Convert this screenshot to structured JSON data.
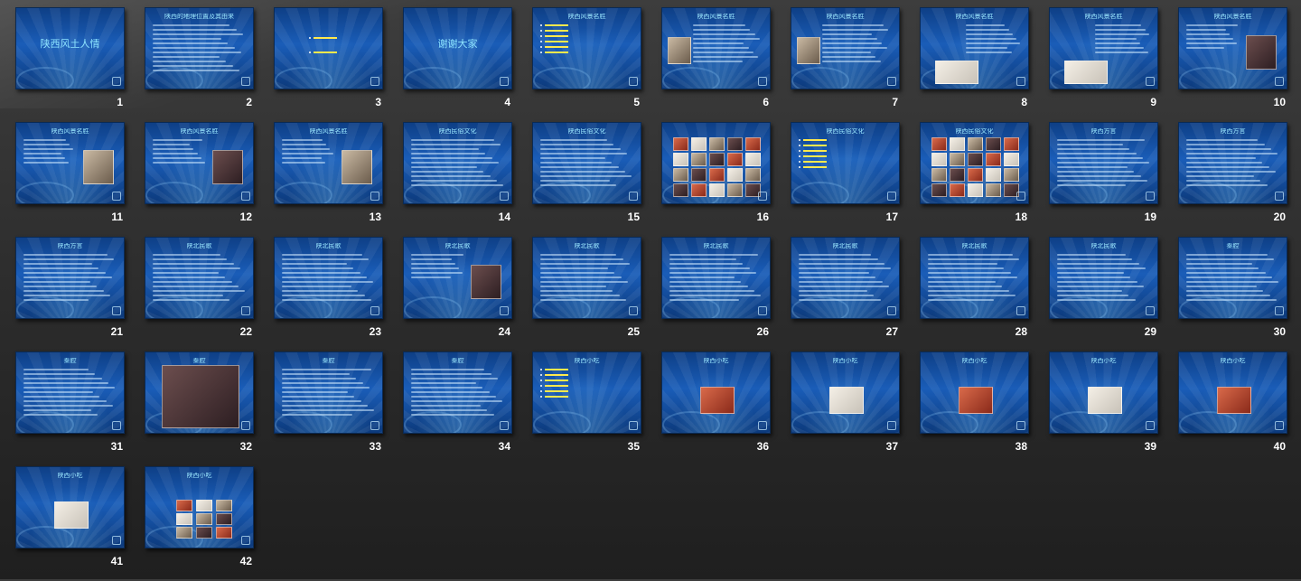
{
  "slides": [
    {
      "n": "1",
      "title": "陕西风土人情",
      "layout": "cover"
    },
    {
      "n": "2",
      "title": "陕西的地理位置及其由来",
      "layout": "text"
    },
    {
      "n": "3",
      "title": "",
      "layout": "menu2"
    },
    {
      "n": "4",
      "title": "谢谢大家",
      "layout": "cover"
    },
    {
      "n": "5",
      "title": "陕西风景名胜",
      "layout": "menu"
    },
    {
      "n": "6",
      "title": "陕西风景名胜",
      "layout": "pic-left"
    },
    {
      "n": "7",
      "title": "陕西风景名胜",
      "layout": "pic-left"
    },
    {
      "n": "8",
      "title": "陕西风景名胜",
      "layout": "pic-bottom"
    },
    {
      "n": "9",
      "title": "陕西风景名胜",
      "layout": "pic-bottom"
    },
    {
      "n": "10",
      "title": "陕西风景名胜",
      "layout": "pic-right"
    },
    {
      "n": "11",
      "title": "陕西风景名胜",
      "layout": "pic-right"
    },
    {
      "n": "12",
      "title": "陕西风景名胜",
      "layout": "pic-right"
    },
    {
      "n": "13",
      "title": "陕西风景名胜",
      "layout": "pic-right"
    },
    {
      "n": "14",
      "title": "陕西民俗文化",
      "layout": "text"
    },
    {
      "n": "15",
      "title": "陕西民俗文化",
      "layout": "text"
    },
    {
      "n": "16",
      "title": "",
      "layout": "grid"
    },
    {
      "n": "17",
      "title": "陕西民俗文化",
      "layout": "menu"
    },
    {
      "n": "18",
      "title": "陕西民俗文化",
      "layout": "grid"
    },
    {
      "n": "19",
      "title": "陕西方言",
      "layout": "text"
    },
    {
      "n": "20",
      "title": "陕西方言",
      "layout": "text"
    },
    {
      "n": "21",
      "title": "陕西方言",
      "layout": "text"
    },
    {
      "n": "22",
      "title": "陕北民歌",
      "layout": "text"
    },
    {
      "n": "23",
      "title": "陕北民歌",
      "layout": "text"
    },
    {
      "n": "24",
      "title": "陕北民歌",
      "layout": "pic-right"
    },
    {
      "n": "25",
      "title": "陕北民歌",
      "layout": "text"
    },
    {
      "n": "26",
      "title": "陕北民歌",
      "layout": "text"
    },
    {
      "n": "27",
      "title": "陕北民歌",
      "layout": "text"
    },
    {
      "n": "28",
      "title": "陕北民歌",
      "layout": "text"
    },
    {
      "n": "29",
      "title": "陕北民歌",
      "layout": "text"
    },
    {
      "n": "30",
      "title": "秦腔",
      "layout": "text"
    },
    {
      "n": "31",
      "title": "秦腔",
      "layout": "text"
    },
    {
      "n": "32",
      "title": "秦腔",
      "layout": "pic-big"
    },
    {
      "n": "33",
      "title": "秦腔",
      "layout": "text"
    },
    {
      "n": "34",
      "title": "秦腔",
      "layout": "text"
    },
    {
      "n": "35",
      "title": "陕西小吃",
      "layout": "menu"
    },
    {
      "n": "36",
      "title": "陕西小吃",
      "layout": "pic-center"
    },
    {
      "n": "37",
      "title": "陕西小吃",
      "layout": "pic-center"
    },
    {
      "n": "38",
      "title": "陕西小吃",
      "layout": "pic-center"
    },
    {
      "n": "39",
      "title": "陕西小吃",
      "layout": "pic-center"
    },
    {
      "n": "40",
      "title": "陕西小吃",
      "layout": "pic-center"
    },
    {
      "n": "41",
      "title": "陕西小吃",
      "layout": "pic-center"
    },
    {
      "n": "42",
      "title": "陕西小吃",
      "layout": "grid"
    }
  ]
}
